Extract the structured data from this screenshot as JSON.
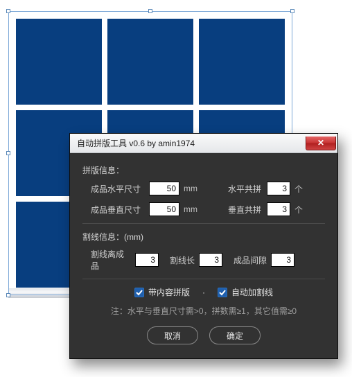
{
  "dialog": {
    "title": "自动拼版工具 v0.6   by amin1974",
    "section_layout": "拼版信息：",
    "field_hsize": "成品水平尺寸",
    "val_hsize": "50",
    "unit_mm": "mm",
    "field_hcount": "水平共拼",
    "val_hcount": "3",
    "unit_count": "个",
    "field_vsize": "成品垂直尺寸",
    "val_vsize": "50",
    "field_vcount": "垂直共拼",
    "val_vcount": "3",
    "section_cut": "割线信息：(mm)",
    "field_cut_off": "割线离成品",
    "val_cut_off": "3",
    "field_cut_len": "割线长",
    "val_cut_len": "3",
    "field_gap": "成品间隙",
    "val_gap": "3",
    "cb_with_content": "带内容拼版",
    "cb_auto_cut": "自动加割线",
    "sep_dot": "·",
    "hint": "注：水平与垂直尺寸需>0，拼数需≥1，其它值需≥0",
    "btn_cancel": "取消",
    "btn_ok": "确定"
  }
}
